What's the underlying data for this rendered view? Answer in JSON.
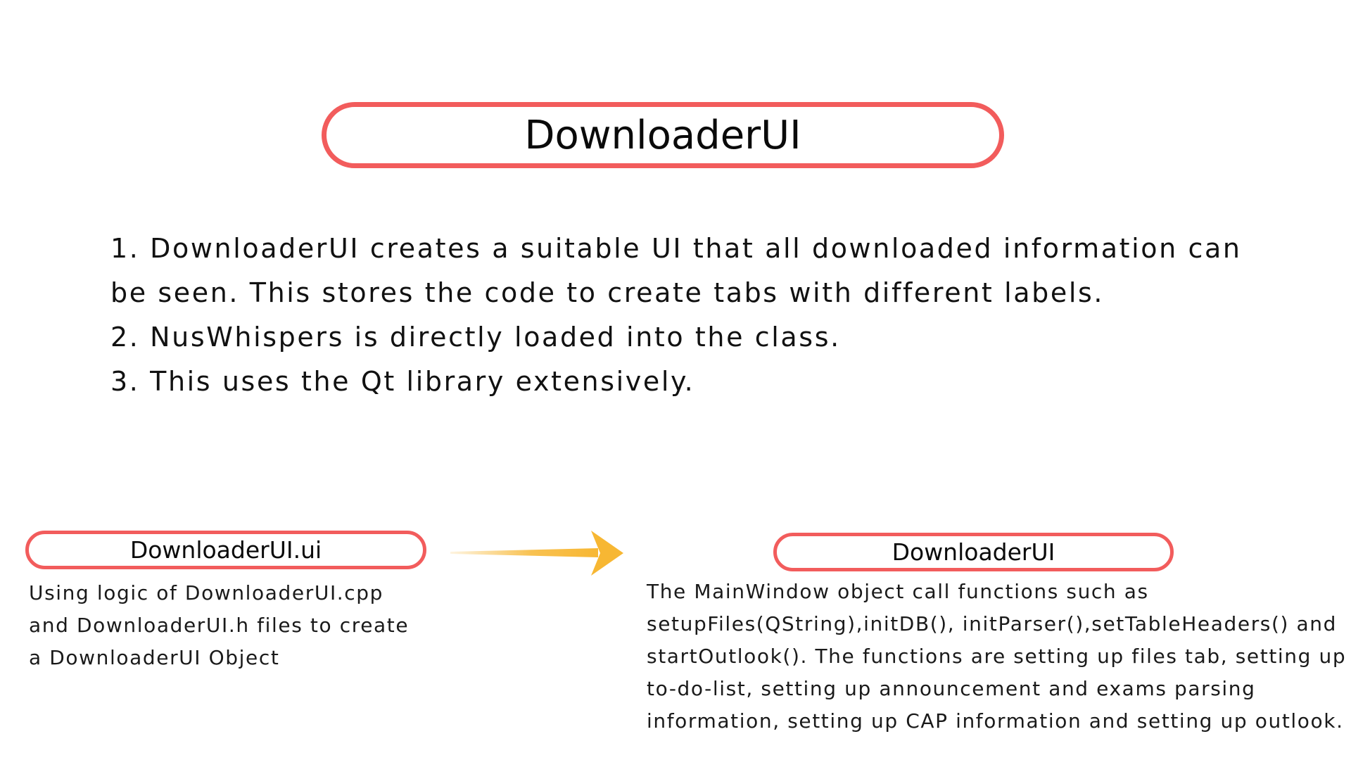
{
  "header": {
    "title": "DownloaderUI"
  },
  "points": [
    "1. DownloaderUI creates a suitable UI that all downloaded information can",
    "be seen. This stores the code to create tabs with different labels.",
    "2. NusWhispers is directly loaded into the class.",
    "3. This uses the Qt library extensively."
  ],
  "flow": {
    "source": {
      "title": "DownloaderUI.ui",
      "description": [
        "Using logic of DownloaderUI.cpp",
        "and DownloaderUI.h files to create",
        "a DownloaderUI Object"
      ]
    },
    "arrow_icon": "arrow-right-icon",
    "target": {
      "title": "DownloaderUI",
      "description": [
        "The MainWindow object call functions such as",
        "setupFiles(QString),initDB(), initParser(),setTableHeaders() and",
        "startOutlook(). The functions are setting up files tab, setting up",
        "to-do-list, setting up announcement and exams parsing",
        "information, setting up CAP information and setting up outlook."
      ]
    }
  },
  "colors": {
    "pill_border": "#f25c5c",
    "arrow_fill": "#f7b733",
    "text": "#111111",
    "background": "#ffffff"
  }
}
